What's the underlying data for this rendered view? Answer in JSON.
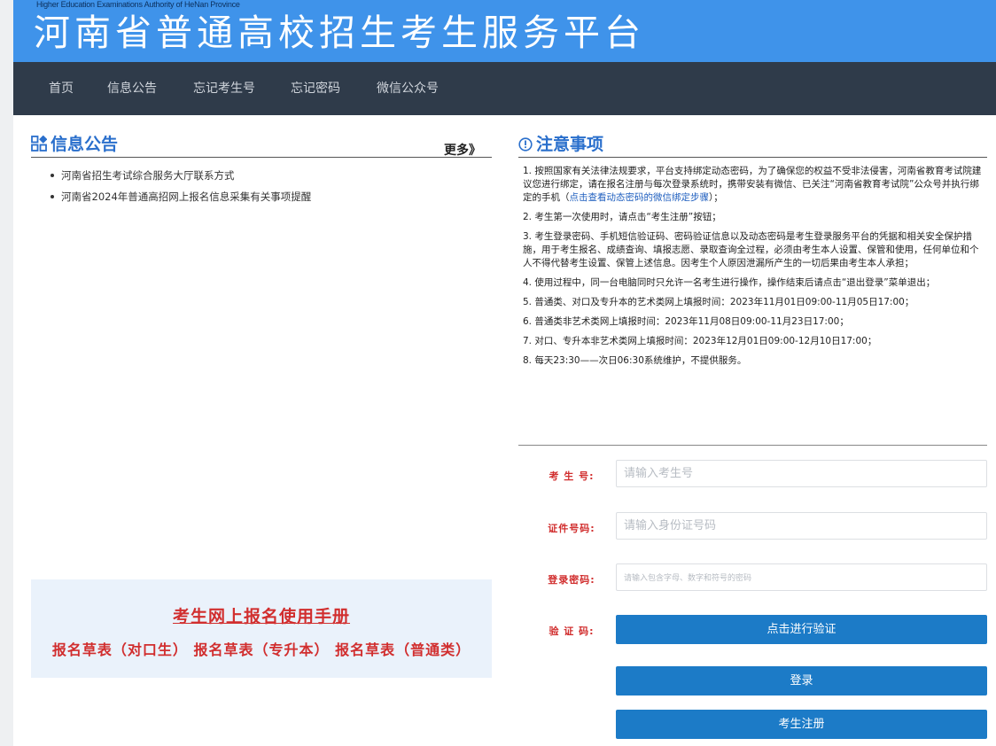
{
  "header": {
    "subtitle": "Higher Education Examinations Authority of HeNan Province",
    "title": "河南省普通高校招生考生服务平台"
  },
  "nav": {
    "items": [
      "首页",
      "信息公告",
      "忘记考生号",
      "忘记密码",
      "微信公众号"
    ]
  },
  "announcements": {
    "title": "信息公告",
    "more_label": "更多》",
    "items": [
      "河南省招生考试综合服务大厅联系方式",
      "河南省2024年普通高招网上报名信息采集有关事项提醒"
    ]
  },
  "manual": {
    "title": "考生网上报名使用手册",
    "links": [
      "报名草表（对口生）",
      "报名草表（专升本）",
      "报名草表（普通类）"
    ]
  },
  "notes": {
    "title": "注意事项",
    "item1_text": "1. 按照国家有关法律法规要求，平台支持绑定动态密码，为了确保您的权益不受非法侵害，河南省教育考试院建议您进行绑定，请在报名注册与每次登录系统时，携带安装有微信、已关注“河南省教育考试院”公众号并执行绑定的手机（",
    "item1_link": "点击查看动态密码的微信绑定步骤",
    "item1_end": "）；",
    "items": [
      "2. 考生第一次使用时，请点击“考生注册”按钮；",
      "3. 考生登录密码、手机短信验证码、密码验证信息以及动态密码是考生登录服务平台的凭据和相关安全保护措施，用于考生报名、成绩查询、填报志愿、录取查询全过程，必须由考生本人设置、保管和使用，任何单位和个人不得代替考生设置、保管上述信息。因考生个人原因泄漏所产生的一切后果由考生本人承担；",
      "4. 使用过程中，同一台电脑同时只允许一名考生进行操作，操作结束后请点击“退出登录”菜单退出；",
      "5. 普通类、对口及专升本的艺术类网上填报时间：2023年11月01日09:00-11月05日17:00；",
      "6. 普通类非艺术类网上填报时间：2023年11月08日09:00-11月23日17:00；",
      "7. 对口、专升本非艺术类网上填报时间：2023年12月01日09:00-12月10日17:00；",
      "8. 每天23:30——次日06:30系统维护，不提供服务。"
    ]
  },
  "login": {
    "exam_no_label": "考 生 号:",
    "exam_no_placeholder": "请输入考生号",
    "id_label": "证件号码:",
    "id_placeholder": "请输入身份证号码",
    "password_label": "登录密码:",
    "password_placeholder": "请输入包含字母、数字和符号的密码",
    "captcha_label": "验 证 码:",
    "verify_button": "点击进行验证",
    "login_button": "登录",
    "register_button": "考生注册"
  },
  "colors": {
    "banner": "#3f93ea",
    "nav": "#2f3b4a",
    "accent_blue": "#2a6fcc",
    "button_blue": "#1c7bc7",
    "label_red": "#d12e2e"
  }
}
